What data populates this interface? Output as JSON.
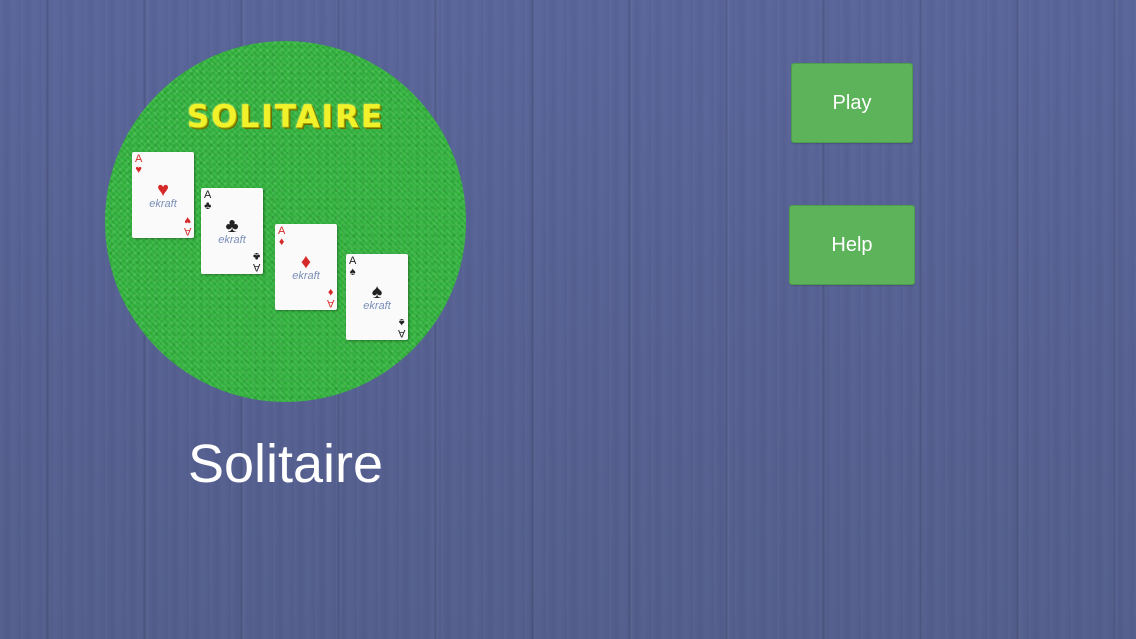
{
  "logo": {
    "title": "SOLITAIRE",
    "cards": [
      {
        "rank": "A",
        "suit": "♥",
        "color": "#d62a2a",
        "brand": "ekraft"
      },
      {
        "rank": "A",
        "suit": "♣",
        "color": "#222222",
        "brand": "ekraft"
      },
      {
        "rank": "A",
        "suit": "♦",
        "color": "#d62a2a",
        "brand": "ekraft"
      },
      {
        "rank": "A",
        "suit": "♠",
        "color": "#222222",
        "brand": "ekraft"
      }
    ]
  },
  "app": {
    "title": "Solitaire"
  },
  "menu": {
    "play_label": "Play",
    "help_label": "Help"
  },
  "colors": {
    "background": "#55608e",
    "felt": "#34b83f",
    "button": "#5cb35a",
    "logo_text": "#f2f22a"
  }
}
